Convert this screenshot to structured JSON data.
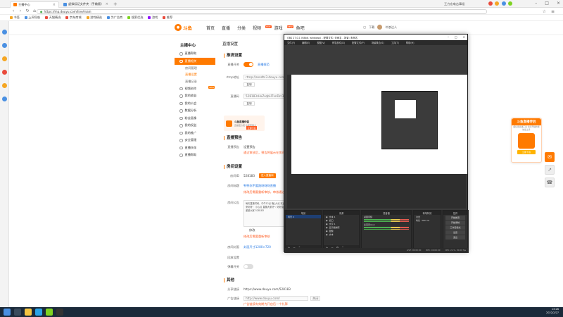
{
  "browser": {
    "tabs": [
      {
        "label": "主播中心",
        "active": true
      },
      {
        "label": "虚拟标记文件夹（手输版）",
        "active": false
      }
    ],
    "url": "https://mp.douyu.com/live/main",
    "user_info": "王力宏电击事组",
    "bookmarks": [
      "书签",
      "上网导航",
      "天猫精选",
      "京东商城",
      "游戏精选",
      "为广告商",
      "搜索优选",
      "游戏",
      "推荐"
    ]
  },
  "header": {
    "logo_text": "斗鱼",
    "nav": [
      "首页",
      "直播",
      "分类",
      "视频",
      "游戏",
      "鱼吧"
    ],
    "nav_badge": "HOT",
    "nav_badge2": "NEW",
    "tools": [
      "下载"
    ],
    "username": "冲浪达人"
  },
  "sidebar": {
    "title": "主播中心",
    "items": [
      {
        "label": "直播帮助"
      },
      {
        "label": "直播相关",
        "active": true
      },
      {
        "label": "房间管理",
        "sub": true
      },
      {
        "label": "直播设置",
        "sub": true,
        "selected": true
      },
      {
        "label": "直播记录",
        "sub": true
      },
      {
        "label": "视频创作",
        "badge": "NEW"
      },
      {
        "label": "我的收益"
      },
      {
        "label": "我的公会"
      },
      {
        "label": "数据分析"
      },
      {
        "label": "粉丝画像"
      },
      {
        "label": "我的权益"
      },
      {
        "label": "我的推广"
      },
      {
        "label": "安全管理"
      },
      {
        "label": "直播伙伴"
      },
      {
        "label": "直播帮助"
      }
    ]
  },
  "content": {
    "page_title": "直播设置",
    "push": {
      "title": "推流设置",
      "live_label": "直播开关",
      "live_link": "直播规范",
      "rtmp_label": "rtmp地址",
      "rtmp_value": "rtmp://sendtc3.douyu.com/live",
      "copy_label": "复制",
      "code_label": "直播码",
      "code_value": "528183rHxZsqbHTxnDcr3",
      "banner_title": "斗鱼直播伴侣",
      "banner_sub": "直播更方便 功能更强大",
      "banner_btn": "立即下载"
    },
    "notice": {
      "title": "直播预告",
      "label": "直播预告",
      "btn": "设置预告",
      "warn": "通过审核后，预告将展示在房间页"
    },
    "room": {
      "title": "房间设置",
      "id_label": "房间ID",
      "id_value": "528183",
      "id_btn": "进入直播间",
      "name_label": "房间标题",
      "name_value": "鸭鸭你不要跑呀呀呀直播",
      "name_warn": "修改后需要重新审核，审核通过后生效",
      "intro_label": "房间公告",
      "intro_text": "每天直播时间，中午12点 晚上8点 欢迎大家来玩呀！ 小心点 直播大家好～ 好好直播吧 谢谢大家 528183",
      "intro_btn": "修改",
      "intro_warn": "修改后需要重新审核",
      "cover_label": "房间封面",
      "cover_link": "封面尺寸1280×720",
      "replay_label": "回放设置",
      "danmu_label": "弹幕开关"
    },
    "other": {
      "title": "其他",
      "share_label": "分享链接",
      "share_value": "https://www.douyu.com/528183",
      "ad_label": "广告链接",
      "ad_value": "http://www.douyu.com/",
      "ad_select": "关闭",
      "ad_warn": "广告链接有效期为开启后一个礼拜"
    }
  },
  "obs": {
    "title": "OBS 27.0.1 (64bit, windows) - 配置文件: 未命名 - 场景: 未命名",
    "menu": [
      "文件(F)",
      "编辑(E)",
      "视图(V)",
      "停靠部件(D)",
      "配置文件(P)",
      "场景集合(S)",
      "工具(T)",
      "帮助(H)"
    ],
    "docks": [
      {
        "title": "场景",
        "items": [
          "场景 2"
        ]
      },
      {
        "title": "来源",
        "items": [
          "文本 1",
          "窗口",
          "文字 1",
          "显示器捕获",
          "图像",
          "文本"
        ]
      },
      {
        "title": "混音器",
        "items": [
          "桌面音频",
          "麦克风/Aux"
        ]
      },
      {
        "title": "转场特效",
        "items": [
          "淡出",
          "时长",
          "300 ms"
        ]
      },
      {
        "title": "控件",
        "items": [
          "开始推流",
          "开始录制",
          "工作室模式",
          "设置",
          "退出"
        ]
      }
    ],
    "status": [
      "LIVE: 00:00:00",
      "REC: 00:00:00",
      "CPU: 2.1%, 30.00 fps"
    ]
  },
  "promo": {
    "title": "斗鱼直播伴侣",
    "sub": "超好用直播工具 新手开播也能快速上手",
    "btn": "立即下载"
  },
  "taskbar": {
    "time": "13:26",
    "date": "2022/2/27"
  },
  "colors": {
    "accent": "#ff7a00",
    "obs_bg": "#3b3b3b",
    "taskbar": "#1b2a3a"
  }
}
